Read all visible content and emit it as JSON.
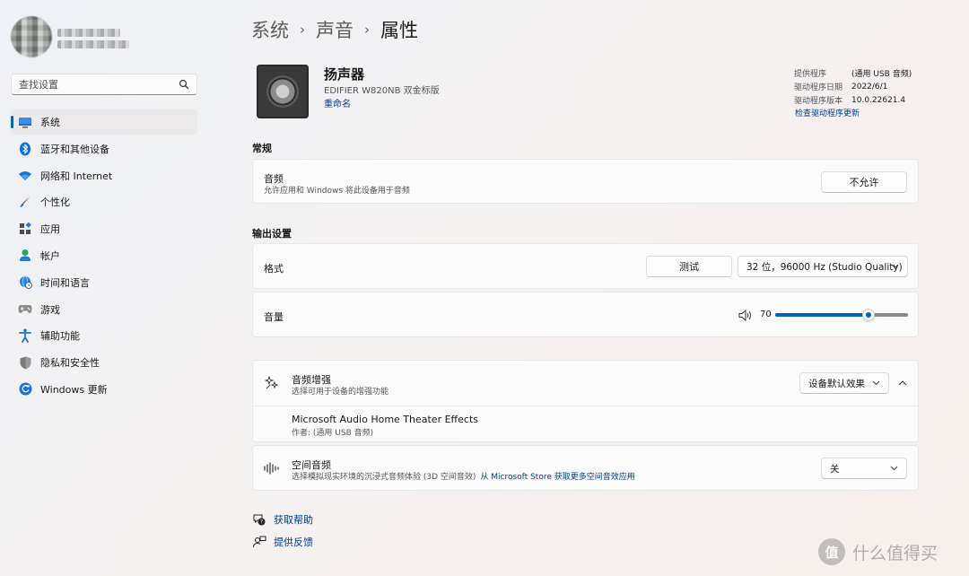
{
  "sidebar": {
    "search_placeholder": "查找设置",
    "items": [
      {
        "label": "系统",
        "icon": "display-icon",
        "active": true
      },
      {
        "label": "蓝牙和其他设备",
        "icon": "bluetooth-icon"
      },
      {
        "label": "网络和 Internet",
        "icon": "wifi-icon"
      },
      {
        "label": "个性化",
        "icon": "brush-icon"
      },
      {
        "label": "应用",
        "icon": "apps-icon"
      },
      {
        "label": "帐户",
        "icon": "account-icon"
      },
      {
        "label": "时间和语言",
        "icon": "globe-clock-icon"
      },
      {
        "label": "游戏",
        "icon": "gamepad-icon"
      },
      {
        "label": "辅助功能",
        "icon": "accessibility-icon"
      },
      {
        "label": "隐私和安全性",
        "icon": "shield-icon"
      },
      {
        "label": "Windows 更新",
        "icon": "update-icon"
      }
    ]
  },
  "breadcrumb": {
    "items": [
      "系统",
      "声音"
    ],
    "current": "属性",
    "separator": "›"
  },
  "device": {
    "name": "扬声器",
    "model": "EDIFIER W820NB 双金标版",
    "rename": "重命名",
    "icon": "speaker-icon"
  },
  "driver": {
    "provider_label": "提供程序",
    "provider_value": "(通用 USB 音频)",
    "date_label": "驱动程序日期",
    "date_value": "2022/6/1",
    "version_label": "驱动程序版本",
    "version_value": "10.0.22621.4",
    "check_link": "检查驱动程序更新"
  },
  "general": {
    "section": "常规",
    "audio_title": "音频",
    "audio_desc": "允许应用和 Windows 将此设备用于音频",
    "audio_button": "不允许"
  },
  "output": {
    "section": "输出设置",
    "format_label": "格式",
    "test_button": "测试",
    "format_value": "32 位，96000 Hz (Studio Quality)",
    "volume_label": "音量",
    "volume_value": "70",
    "volume_fraction": 0.7
  },
  "enhance": {
    "title": "音频增强",
    "desc": "选择可用于设备的增强功能",
    "dropdown": "设备默认效果",
    "item_title": "Microsoft Audio Home Theater Effects",
    "item_author": "作者: (通用 USB 音频)"
  },
  "spatial": {
    "title": "空间音频",
    "desc": "选择模拟现实环境的沉浸式音频体验 (3D 空间音效)",
    "store_link": "从 Microsoft Store 获取更多空间音效应用",
    "dropdown": "关"
  },
  "footer": {
    "help": "获取帮助",
    "feedback": "提供反馈"
  },
  "watermark": {
    "text": "什么值得买",
    "icon_char": "值"
  },
  "colors": {
    "accent": "#005fb8",
    "link": "#003e92"
  }
}
